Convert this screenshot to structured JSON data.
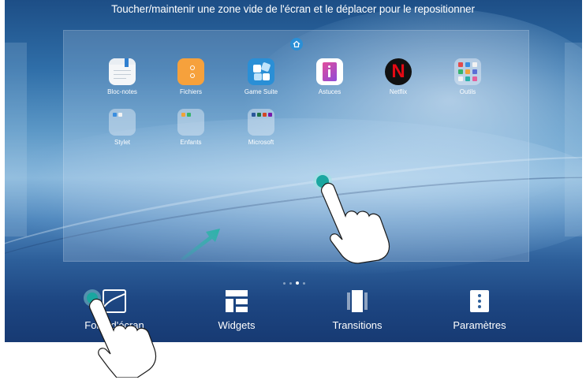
{
  "instruction_text": "Toucher/maintenir une zone vide de l'écran et le déplacer pour le repositionner",
  "apps_row1": [
    {
      "label": "Bloc-notes",
      "icon": "notes-icon"
    },
    {
      "label": "Fichiers",
      "icon": "files-icon"
    },
    {
      "label": "Game Suite",
      "icon": "game-suite-icon"
    },
    {
      "label": "Astuces",
      "icon": "tips-icon"
    },
    {
      "label": "Netflix",
      "icon": "netflix-icon"
    },
    {
      "label": "Outils",
      "icon": "tools-folder-icon"
    }
  ],
  "apps_row2": [
    {
      "label": "Stylet",
      "icon": "stylus-folder-icon"
    },
    {
      "label": "Enfants",
      "icon": "kids-folder-icon"
    },
    {
      "label": "Microsoft",
      "icon": "microsoft-folder-icon"
    }
  ],
  "page_indicator": {
    "pages": 4,
    "current": 3
  },
  "toolbar": [
    {
      "label": "Fond d'écran",
      "icon": "wallpaper-icon"
    },
    {
      "label": "Widgets",
      "icon": "widgets-icon"
    },
    {
      "label": "Transitions",
      "icon": "transitions-icon"
    },
    {
      "label": "Paramètres",
      "icon": "settings-icon"
    }
  ],
  "colors": {
    "accent": "#2a8fd6",
    "touch_point": "#1aa7a0",
    "arrow": "#2bb3a8"
  }
}
